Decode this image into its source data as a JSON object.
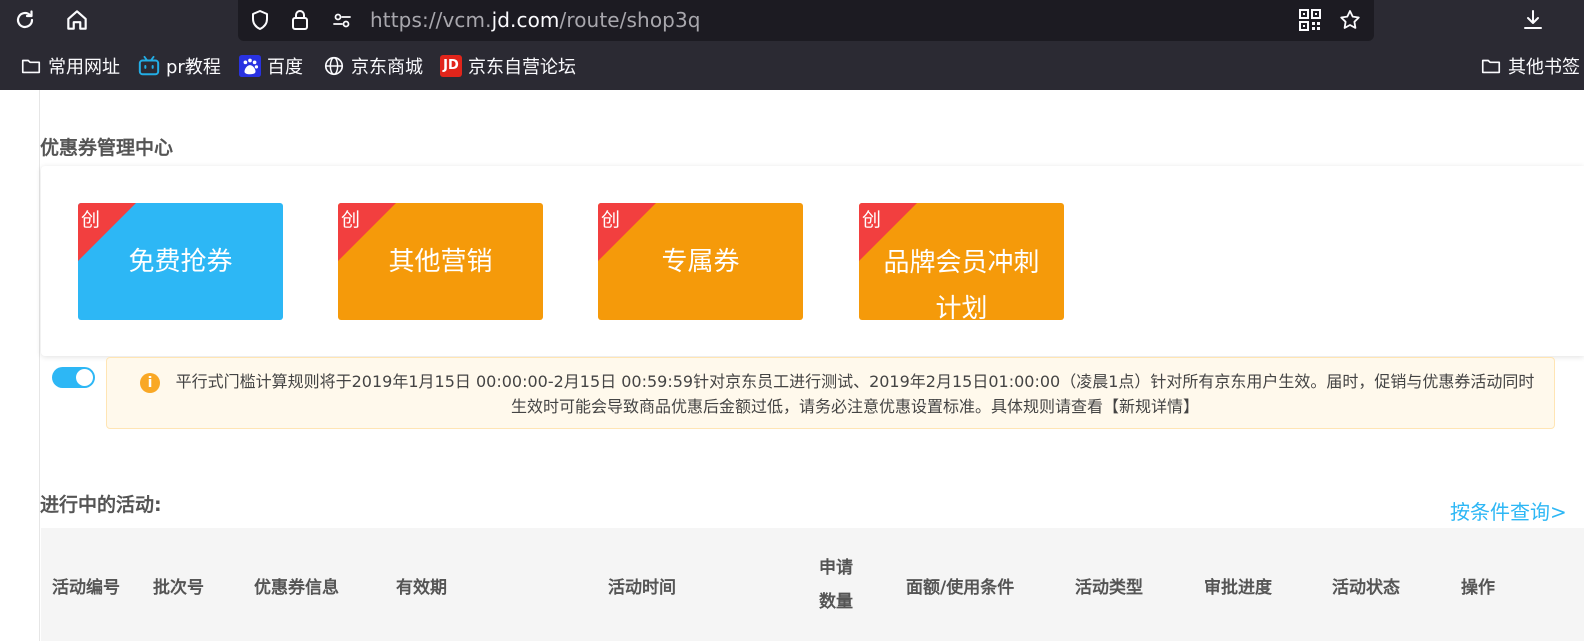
{
  "browser": {
    "url_prefix": "https://vcm.",
    "url_domain": "jd.com",
    "url_path": "/route/shop3q",
    "bookmarks": [
      {
        "label": "常用网址",
        "icon": "folder-icon"
      },
      {
        "label": "pr教程",
        "icon": "bilibili-icon"
      },
      {
        "label": "百度",
        "icon": "baidu-icon"
      },
      {
        "label": "京东商城",
        "icon": "globe-icon"
      },
      {
        "label": "京东自营论坛",
        "icon": "jd-icon",
        "icon_text": "JD"
      },
      {
        "label": "其他书签",
        "icon": "folder-icon"
      }
    ]
  },
  "page": {
    "title": "优惠券管理中心",
    "tiles": [
      {
        "label": "免费抢券",
        "badge": "创",
        "color": "#2db7f5"
      },
      {
        "label": "其他营销",
        "badge": "创",
        "color": "#f59a0a"
      },
      {
        "label": "专属券",
        "badge": "创",
        "color": "#f59a0a"
      },
      {
        "label": "品牌会员冲刺计划",
        "badge": "创",
        "color": "#f59a0a"
      }
    ],
    "notice": {
      "icon_text": "i",
      "text": "平行式门槛计算规则将于2019年1月15日 00:00:00-2月15日 00:59:59针对京东员工进行测试、2019年2月15日01:00:00（凌晨1点）针对所有京东用户生效。届时，促销与优惠券活动同时生效时可能会导致商品优惠后金额过低，请务必注意优惠设置标准。具体规则请查看【新规详情】"
    },
    "active_section": {
      "title": "进行中的活动:",
      "query_link": "按条件查询>"
    },
    "table": {
      "columns": [
        "活动编号",
        "批次号",
        "优惠券信息",
        "有效期",
        "活动时间",
        "申请数量",
        "面额/使用条件",
        "活动类型",
        "审批进度",
        "活动状态",
        "操作"
      ]
    }
  },
  "colors": {
    "accent": "#2db7f5",
    "orange": "#f59a0a",
    "badge_red": "#f23f3f",
    "notice_bg": "#fff9ec"
  }
}
